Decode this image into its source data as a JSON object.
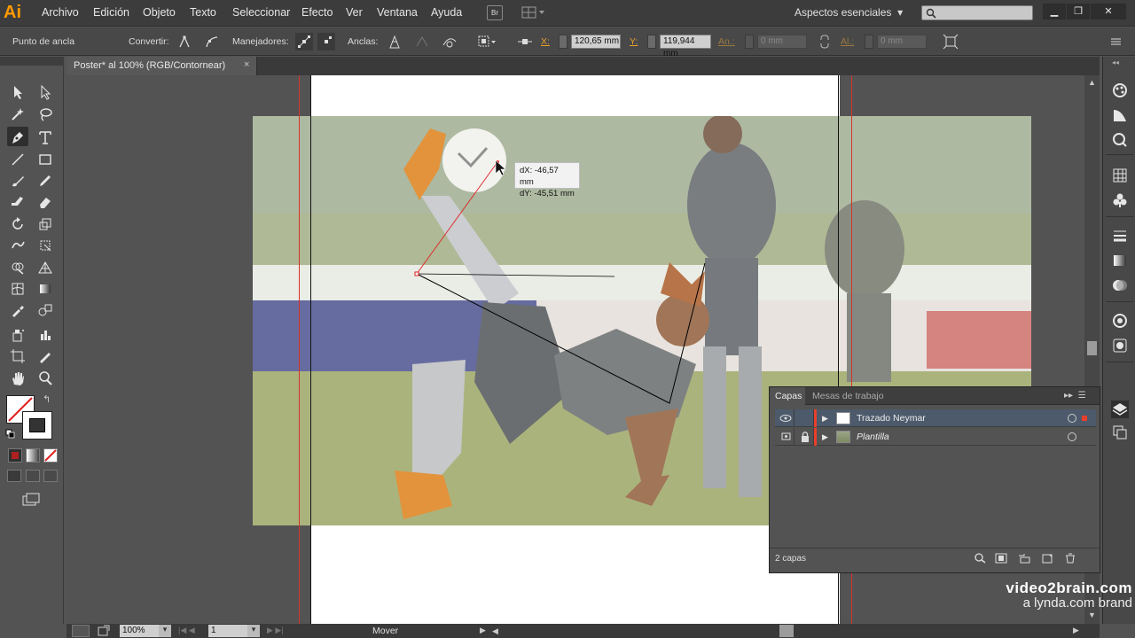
{
  "app": {
    "logo": "Ai"
  },
  "menu": [
    "Archivo",
    "Edición",
    "Objeto",
    "Texto",
    "Seleccionar",
    "Efecto",
    "Ver",
    "Ventana",
    "Ayuda"
  ],
  "menubar": {
    "bridge_label": "Br",
    "workspace": "Aspectos esenciales",
    "search_placeholder": ""
  },
  "control": {
    "anchor_label": "Punto de ancla",
    "convert_label": "Convertir:",
    "handles_label": "Manejadores:",
    "anchors_label": "Anclas:",
    "x_label": "X:",
    "x_value": "120,65 mm",
    "y_label": "Y:",
    "y_value": "119,944 mm",
    "w_label": "An.:",
    "w_value": "0 mm",
    "h_label": "Al.:",
    "h_value": "0 mm"
  },
  "document": {
    "tab_title": "Poster* al 100% (RGB/Contornear)",
    "close": "×"
  },
  "tooltip": {
    "dx": "dX: -46,57 mm",
    "dy": "dY: -45,51 mm"
  },
  "layers": {
    "tabs": [
      "Capas",
      "Mesas de trabajo"
    ],
    "items": [
      {
        "name": "Trazado Neymar",
        "selected": true
      },
      {
        "name": "Plantilla",
        "selected": false
      }
    ],
    "count": "2 capas"
  },
  "status": {
    "zoom": "100%",
    "page": "1",
    "tool": "Mover"
  },
  "watermark": {
    "line1": "video2brain.com",
    "line2": "a lynda.com brand"
  },
  "colors": {
    "accent_orange": "#ff9a00",
    "layer_color": "#e8402c",
    "bleed_red": "#d8332a",
    "selection_blue": "#4c5a6b"
  }
}
